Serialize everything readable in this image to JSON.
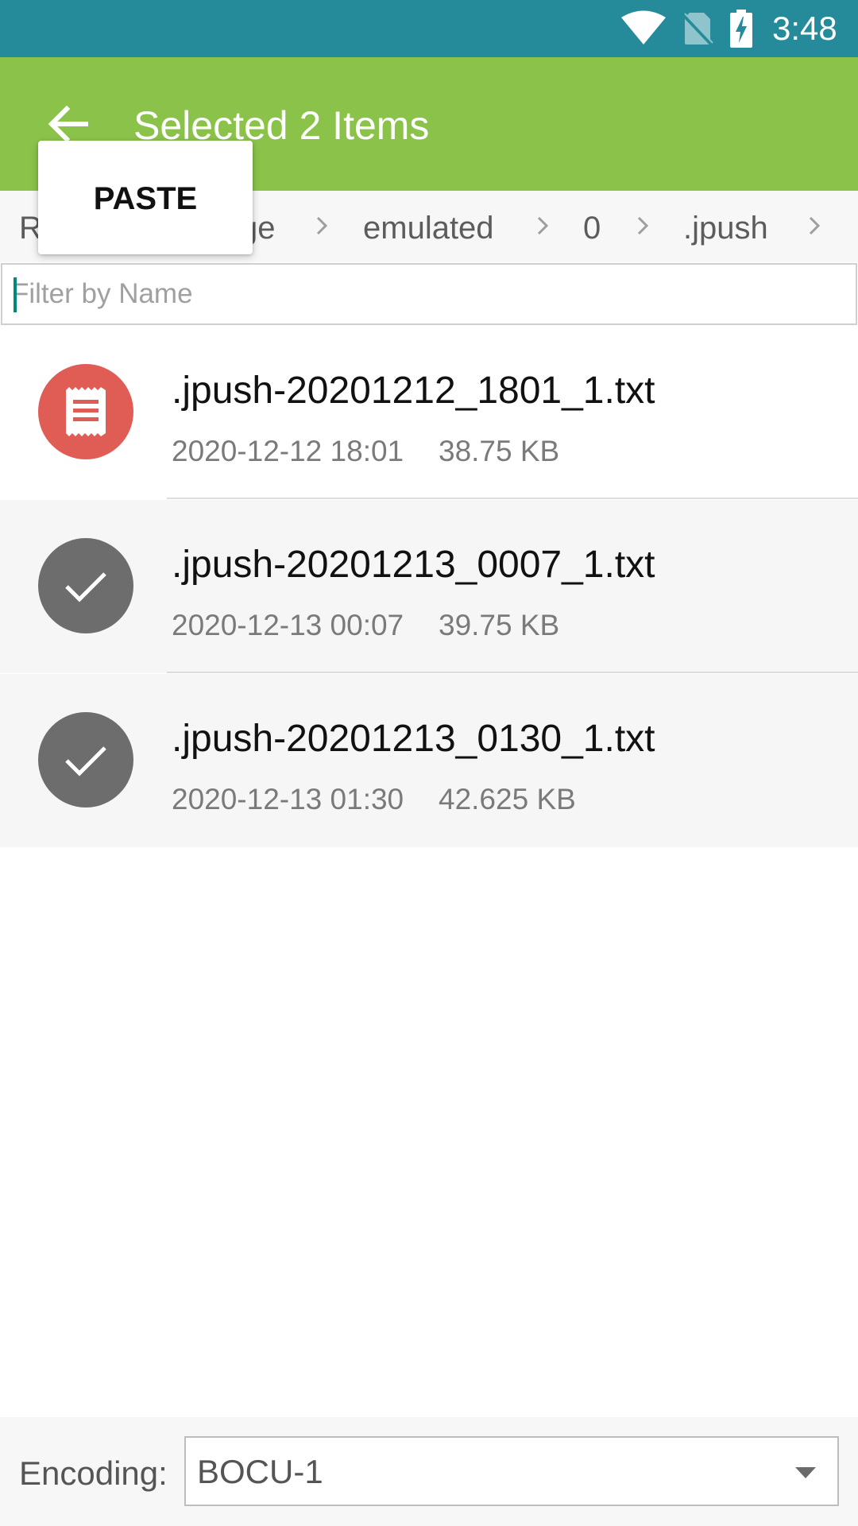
{
  "status_bar": {
    "time": "3:48",
    "icons": [
      "wifi-icon",
      "no-sim-icon",
      "battery-charging-icon"
    ],
    "background": "#258b9b"
  },
  "app_bar": {
    "title": "Selected 2 Items",
    "back_icon": "arrow-back-icon",
    "background": "#8bc34a"
  },
  "popup_menu": {
    "items": [
      {
        "label": "PASTE"
      }
    ]
  },
  "breadcrumb": {
    "items": [
      "R",
      "ge",
      "emulated",
      "0",
      ".jpush"
    ],
    "separator_icon": "chevron-right-icon"
  },
  "filter": {
    "placeholder": "Filter by Name",
    "value": ""
  },
  "files": [
    {
      "name": ".jpush-20201212_1801_1.txt",
      "date": "2020-12-12 18:01",
      "size": "38.75 KB",
      "selected": false,
      "icon": "document-icon",
      "icon_color": "#e05d55"
    },
    {
      "name": ".jpush-20201213_0007_1.txt",
      "date": "2020-12-13 00:07",
      "size": "39.75 KB",
      "selected": true,
      "icon": "check-icon",
      "icon_color": "#6d6d6d"
    },
    {
      "name": ".jpush-20201213_0130_1.txt",
      "date": "2020-12-13 01:30",
      "size": "42.625 KB",
      "selected": true,
      "icon": "check-icon",
      "icon_color": "#6d6d6d"
    }
  ],
  "encoding": {
    "label": "Encoding:",
    "value": "BOCU-1",
    "dropdown_icon": "dropdown-arrow-icon"
  }
}
